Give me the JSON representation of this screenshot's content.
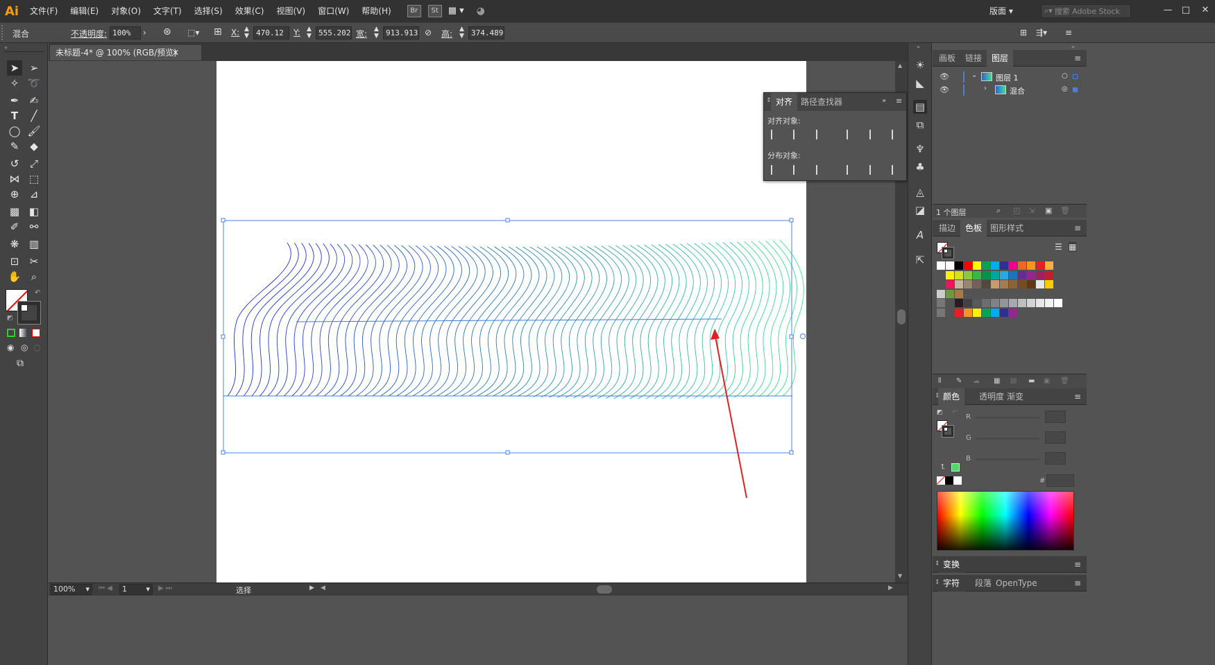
{
  "app": {
    "logo": "Ai"
  },
  "menu": [
    "文件(F)",
    "编辑(E)",
    "对象(O)",
    "文字(T)",
    "选择(S)",
    "效果(C)",
    "视图(V)",
    "窗口(W)",
    "帮助(H)"
  ],
  "menu_boxes": [
    "Br",
    "St"
  ],
  "workspace": "版面",
  "search": {
    "placeholder": "搜索 Adobe Stock"
  },
  "window_controls": {
    "minimize": "—",
    "maximize": "□",
    "close": "✕"
  },
  "control": {
    "selection_type": "混合",
    "opacity_label": "不透明度:",
    "opacity_value": "100%",
    "x_label": "X:",
    "x_value": "470.12 p",
    "y_label": "Y:",
    "y_value": "555.202",
    "w_label": "宽:",
    "w_value": "913.913",
    "h_label": "高:",
    "h_value": "374.489"
  },
  "document": {
    "tab_title": "未标题-4* @ 100% (RGB/预览)",
    "close": "✕"
  },
  "status": {
    "zoom": "100%",
    "page": "1",
    "tool": "选择"
  },
  "align_panel": {
    "tabs": [
      "对齐",
      "路径查找器"
    ],
    "align_objects_label": "对齐对象:",
    "distribute_objects_label": "分布对象:"
  },
  "layers_panel": {
    "tabs": [
      "画板",
      "链接",
      "图层"
    ],
    "rows": [
      {
        "name": "图层 1"
      },
      {
        "name": "混合"
      }
    ],
    "footer": "1 个图层"
  },
  "swatches_panel": {
    "tabs": [
      "描边",
      "色板",
      "图形样式"
    ]
  },
  "swatch_colors": {
    "row1": [
      "#ffffff",
      "#000000",
      "#ff0000",
      "#ffff00",
      "#00a651",
      "#00aeef",
      "#2e3192",
      "#ec008c",
      "#f26522",
      "#f7941d",
      "#ed1c24",
      "#fbb040"
    ],
    "row2": [
      "#fff200",
      "#d7df23",
      "#8dc63f",
      "#39b54a",
      "#009444",
      "#00a79d",
      "#27aae1",
      "#1c75bc",
      "#662d91",
      "#92278f",
      "#9e1f63",
      "#be1e2d"
    ],
    "row3": [
      "#ed145b",
      "#c2b59b",
      "#998675",
      "#736357",
      "#534741",
      "#c69c6d",
      "#a67c52",
      "#8c6239",
      "#754c24",
      "#603813",
      "#e6e7e8",
      "#ffcc00"
    ],
    "row5": [
      "#231f20",
      "#414042",
      "#58595b",
      "#6d6e71",
      "#808285",
      "#939598",
      "#a7a9ac",
      "#bcbec0",
      "#d1d3d4",
      "#e6e7e8",
      "#f1f2f2",
      "#ffffff"
    ],
    "row6": [
      "#ed1c24",
      "#f7941d",
      "#fff200",
      "#00a651",
      "#00aeef",
      "#2e3192",
      "#92278f"
    ]
  },
  "color_panel": {
    "tabs": [
      "颜色",
      "透明度",
      "渐变"
    ],
    "r_label": "R",
    "g_label": "G",
    "b_label": "B",
    "hex_label": "#",
    "fill_color": "#4cd964"
  },
  "transform_panel": {
    "title": "变换"
  },
  "char_panel": {
    "tabs": [
      "字符",
      "段落",
      "OpenType"
    ]
  },
  "artwork": {
    "gradient_start": "#1e2ed8",
    "gradient_end": "#3ee08a",
    "arrow_color": "#e02020"
  }
}
